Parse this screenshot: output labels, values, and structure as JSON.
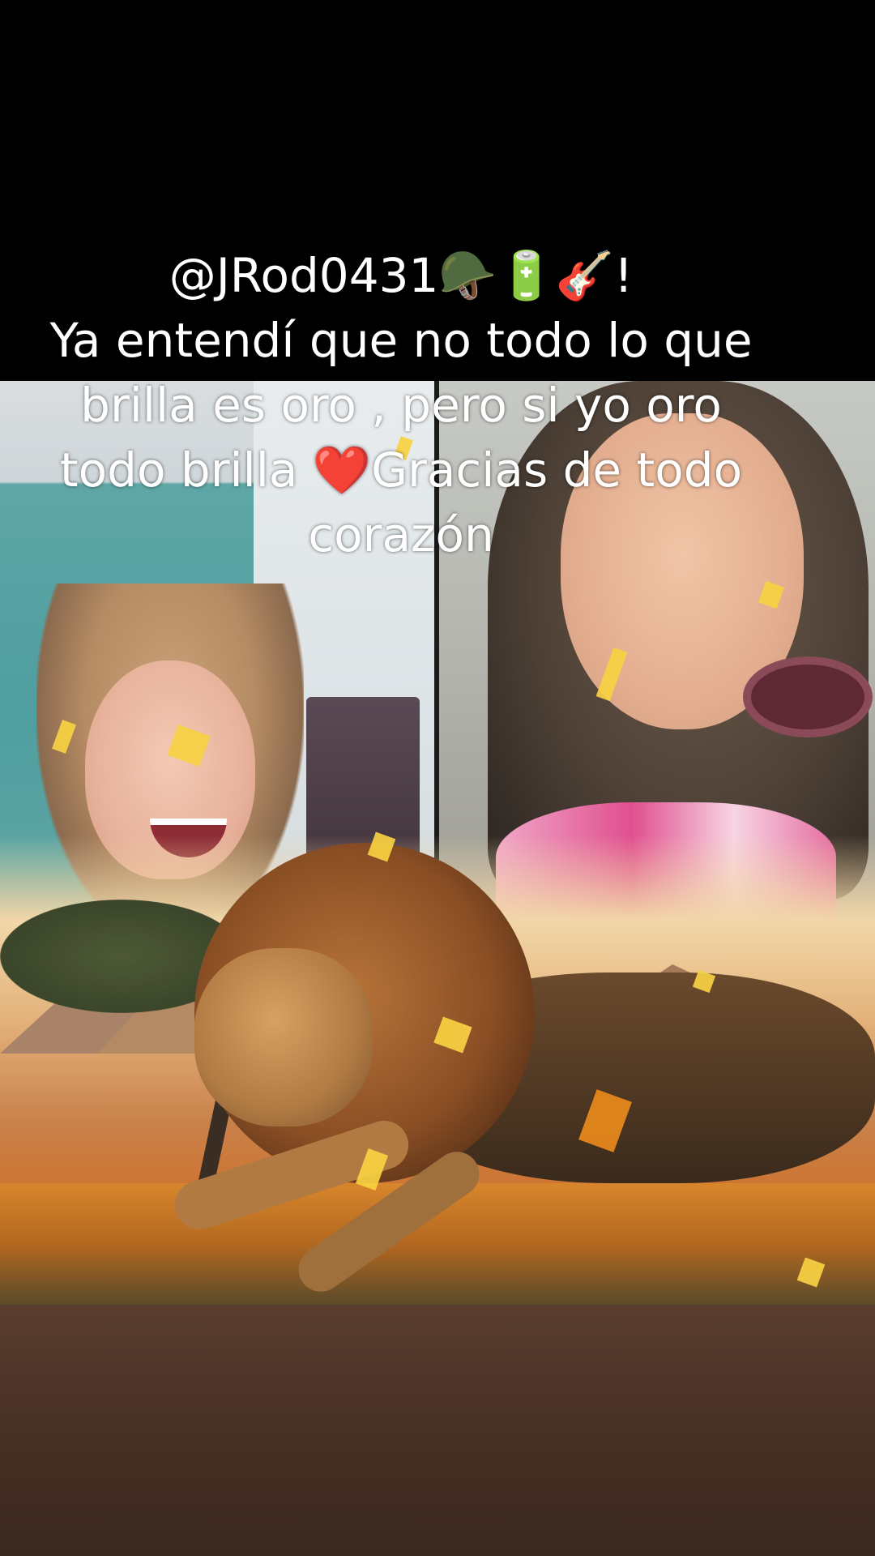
{
  "caption": {
    "handle_line": "@JRod0431🪖🔋🎸!",
    "message": "Ya entendí que no todo lo que brilla es oro , pero si yo oro todo brilla ❤️Gracias de todo corazón"
  },
  "icons": [
    "helmet-emoji",
    "battery-emoji",
    "guitar-emoji",
    "red-heart-emoji"
  ],
  "colors": {
    "caption_text": "#ffffff",
    "top_band": "#000000",
    "confetti": "#f7d142"
  }
}
